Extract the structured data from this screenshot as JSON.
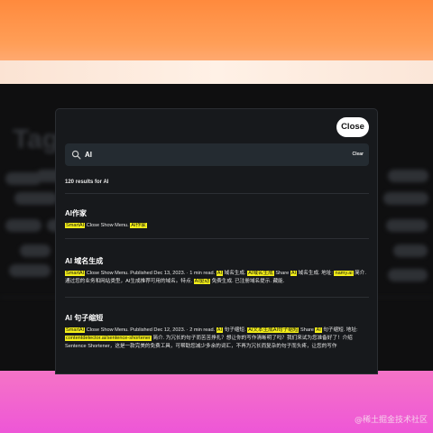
{
  "modal": {
    "close_label": "Close",
    "search": {
      "value": "AI",
      "placeholder": "Search",
      "clear_label": "Clear"
    },
    "results_count": "120 results for AI",
    "results": [
      {
        "title": "AI作家",
        "snippet": [
          {
            "text": "SmartAI",
            "hl": true
          },
          {
            "text": " Close Show Menu. ",
            "hl": false
          },
          {
            "text": "AI作家",
            "hl": true
          }
        ]
      },
      {
        "title": "AI 域名生成",
        "snippet": [
          {
            "text": "SmartAI",
            "hl": true
          },
          {
            "text": " Close Show Menu. Published Dec 13, 2023. · 1 min read. ",
            "hl": false
          },
          {
            "text": "AI",
            "hl": true
          },
          {
            "text": " 域名生成. ",
            "hl": false
          },
          {
            "text": "AI域名生成",
            "hl": true
          },
          {
            "text": " Share ",
            "hl": false
          },
          {
            "text": "AI",
            "hl": true
          },
          {
            "text": " 域名生成. 地址: ",
            "hl": false
          },
          {
            "text": "namy.ai",
            "hl": true
          },
          {
            "text": " 简介. 通过您的业务和网站类型，AI生成推荐可用的域名。特点. ",
            "hl": false
          },
          {
            "text": "AI驱动",
            "hl": true
          },
          {
            "text": " 免费生成. 已注册域名提示. 藏能.",
            "hl": false
          }
        ]
      },
      {
        "title": "AI 句子缩短",
        "snippet": [
          {
            "text": "SmartAI",
            "hl": true
          },
          {
            "text": " Close Show Menu. Published Dec 12, 2023. · 2 min read. ",
            "hl": false
          },
          {
            "text": "AI",
            "hl": true
          },
          {
            "text": " 句子缩短. ",
            "hl": false
          },
          {
            "text": "AI文本生成AI句子缩短",
            "hl": true
          },
          {
            "text": " Share ",
            "hl": false
          },
          {
            "text": "AI",
            "hl": true
          },
          {
            "text": " 句子缩短. 地址: ",
            "hl": false
          },
          {
            "text": "contentdetector.ai/sentence-shortener",
            "hl": true
          },
          {
            "text": " 简介. 为冗长的句子而苦苦挣扎？想让你的写作清晰明了吗？我们来试为您准备好了！介绍 Sentence Shortener，这是一款完美的免费工具，可帮助您减少多余的词汇，不再为冗长而复杂的句子而头疼，让您的写作",
            "hl": false
          }
        ]
      }
    ]
  },
  "background": {
    "title": "Tags"
  },
  "watermark": "@稀土掘金技术社区",
  "colors": {
    "highlight": "#f4ef19",
    "modal_bg": "#17191c",
    "search_bg": "#242b31"
  }
}
